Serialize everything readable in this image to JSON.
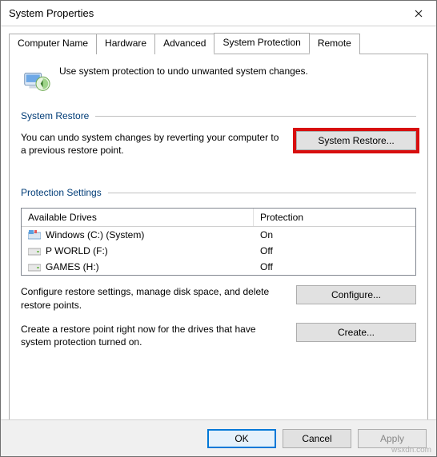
{
  "window": {
    "title": "System Properties"
  },
  "tabs": {
    "computer_name": "Computer Name",
    "hardware": "Hardware",
    "advanced": "Advanced",
    "system_protection": "System Protection",
    "remote": "Remote"
  },
  "intro_text": "Use system protection to undo unwanted system changes.",
  "groups": {
    "system_restore": "System Restore",
    "protection_settings": "Protection Settings"
  },
  "system_restore": {
    "desc": "You can undo system changes by reverting your computer to a previous restore point.",
    "button": "System Restore..."
  },
  "table": {
    "col_drive": "Available Drives",
    "col_protection": "Protection",
    "rows": [
      {
        "name": "Windows (C:) (System)",
        "protection": "On",
        "kind": "system"
      },
      {
        "name": "P WORLD (F:)",
        "protection": "Off",
        "kind": "hdd"
      },
      {
        "name": "GAMES (H:)",
        "protection": "Off",
        "kind": "hdd"
      }
    ]
  },
  "configure": {
    "desc": "Configure restore settings, manage disk space, and delete restore points.",
    "button": "Configure..."
  },
  "create": {
    "desc": "Create a restore point right now for the drives that have system protection turned on.",
    "button": "Create..."
  },
  "buttons": {
    "ok": "OK",
    "cancel": "Cancel",
    "apply": "Apply"
  },
  "watermark": "wsxdn.com"
}
